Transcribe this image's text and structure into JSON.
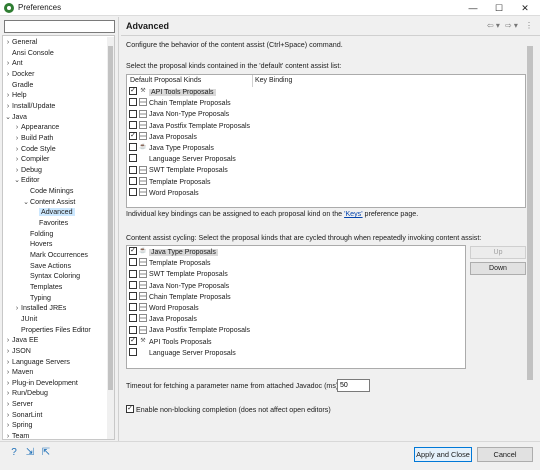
{
  "window": {
    "title": "Preferences",
    "minimize": "—",
    "maximize": "☐",
    "close": "✕"
  },
  "tree": {
    "filter_placeholder": "",
    "items": [
      {
        "label": "General",
        "twisty": "›",
        "indent": 0
      },
      {
        "label": "Ansi Console",
        "twisty": "",
        "indent": 0
      },
      {
        "label": "Ant",
        "twisty": "›",
        "indent": 0
      },
      {
        "label": "Docker",
        "twisty": "›",
        "indent": 0
      },
      {
        "label": "Gradle",
        "twisty": "",
        "indent": 0
      },
      {
        "label": "Help",
        "twisty": "›",
        "indent": 0
      },
      {
        "label": "Install/Update",
        "twisty": "›",
        "indent": 0
      },
      {
        "label": "Java",
        "twisty": "⌄",
        "indent": 0
      },
      {
        "label": "Appearance",
        "twisty": "›",
        "indent": 1
      },
      {
        "label": "Build Path",
        "twisty": "›",
        "indent": 1
      },
      {
        "label": "Code Style",
        "twisty": "›",
        "indent": 1
      },
      {
        "label": "Compiler",
        "twisty": "›",
        "indent": 1
      },
      {
        "label": "Debug",
        "twisty": "›",
        "indent": 1
      },
      {
        "label": "Editor",
        "twisty": "⌄",
        "indent": 1
      },
      {
        "label": "Code Minings",
        "twisty": "",
        "indent": 2
      },
      {
        "label": "Content Assist",
        "twisty": "⌄",
        "indent": 2
      },
      {
        "label": "Advanced",
        "twisty": "",
        "indent": 3,
        "selected": true
      },
      {
        "label": "Favorites",
        "twisty": "",
        "indent": 3
      },
      {
        "label": "Folding",
        "twisty": "",
        "indent": 2
      },
      {
        "label": "Hovers",
        "twisty": "",
        "indent": 2
      },
      {
        "label": "Mark Occurrences",
        "twisty": "",
        "indent": 2
      },
      {
        "label": "Save Actions",
        "twisty": "",
        "indent": 2
      },
      {
        "label": "Syntax Coloring",
        "twisty": "",
        "indent": 2
      },
      {
        "label": "Templates",
        "twisty": "",
        "indent": 2
      },
      {
        "label": "Typing",
        "twisty": "",
        "indent": 2
      },
      {
        "label": "Installed JREs",
        "twisty": "›",
        "indent": 1
      },
      {
        "label": "JUnit",
        "twisty": "",
        "indent": 1
      },
      {
        "label": "Properties Files Editor",
        "twisty": "",
        "indent": 1
      },
      {
        "label": "Java EE",
        "twisty": "›",
        "indent": 0
      },
      {
        "label": "JSON",
        "twisty": "›",
        "indent": 0
      },
      {
        "label": "Language Servers",
        "twisty": "›",
        "indent": 0
      },
      {
        "label": "Maven",
        "twisty": "›",
        "indent": 0
      },
      {
        "label": "Plug-in Development",
        "twisty": "›",
        "indent": 0
      },
      {
        "label": "Run/Debug",
        "twisty": "›",
        "indent": 0
      },
      {
        "label": "Server",
        "twisty": "›",
        "indent": 0
      },
      {
        "label": "SonarLint",
        "twisty": "›",
        "indent": 0
      },
      {
        "label": "Spring",
        "twisty": "›",
        "indent": 0
      },
      {
        "label": "Team",
        "twisty": "›",
        "indent": 0
      }
    ]
  },
  "page": {
    "title": "Advanced",
    "description": "Configure the behavior of the content assist (Ctrl+Space) command.",
    "default_section_label": "Select the proposal kinds contained in the 'default' content assist list:",
    "default_col1": "Default Proposal Kinds",
    "default_col2": "Key Binding",
    "default_kinds": [
      {
        "label": "API Tools Proposals",
        "checked": true,
        "icon": "tool",
        "hl": true
      },
      {
        "label": "Chain Template Proposals",
        "checked": false,
        "icon": "grid"
      },
      {
        "label": "Java Non-Type Proposals",
        "checked": false,
        "icon": "grid"
      },
      {
        "label": "Java Postfix Template Proposals",
        "checked": false,
        "icon": "grid"
      },
      {
        "label": "Java Proposals",
        "checked": true,
        "icon": "grid"
      },
      {
        "label": "Java Type Proposals",
        "checked": false,
        "icon": "java"
      },
      {
        "label": "Language Server Proposals",
        "checked": false,
        "icon": "none"
      },
      {
        "label": "SWT Template Proposals",
        "checked": false,
        "icon": "grid"
      },
      {
        "label": "Template Proposals",
        "checked": false,
        "icon": "grid"
      },
      {
        "label": "Word Proposals",
        "checked": false,
        "icon": "grid"
      }
    ],
    "keys_note_before": "Individual key bindings can be assigned to each proposal kind on the ",
    "keys_link": "'Keys'",
    "keys_note_after": " preference page.",
    "cycling_label": "Content assist cycling: Select the proposal kinds that are cycled through when repeatedly invoking content assist:",
    "cycling_kinds": [
      {
        "label": "Java Type Proposals",
        "checked": true,
        "icon": "java",
        "hl": true
      },
      {
        "label": "Template Proposals",
        "checked": false,
        "icon": "grid"
      },
      {
        "label": "SWT Template Proposals",
        "checked": false,
        "icon": "grid"
      },
      {
        "label": "Java Non-Type Proposals",
        "checked": false,
        "icon": "grid"
      },
      {
        "label": "Chain Template Proposals",
        "checked": false,
        "icon": "grid"
      },
      {
        "label": "Word Proposals",
        "checked": false,
        "icon": "grid"
      },
      {
        "label": "Java Proposals",
        "checked": false,
        "icon": "grid"
      },
      {
        "label": "Java Postfix Template Proposals",
        "checked": false,
        "icon": "grid"
      },
      {
        "label": "API Tools Proposals",
        "checked": true,
        "icon": "tool"
      },
      {
        "label": "Language Server Proposals",
        "checked": false,
        "icon": "none"
      }
    ],
    "up_label": "Up",
    "down_label": "Down",
    "timeout_label": "Timeout for fetching a parameter name from attached Javadoc (ms):",
    "timeout_value": "50",
    "nonblocking_label": "Enable non-blocking completion (does not affect open editors)",
    "nonblocking_checked": true
  },
  "footer": {
    "apply_close": "Apply and Close",
    "cancel": "Cancel"
  }
}
